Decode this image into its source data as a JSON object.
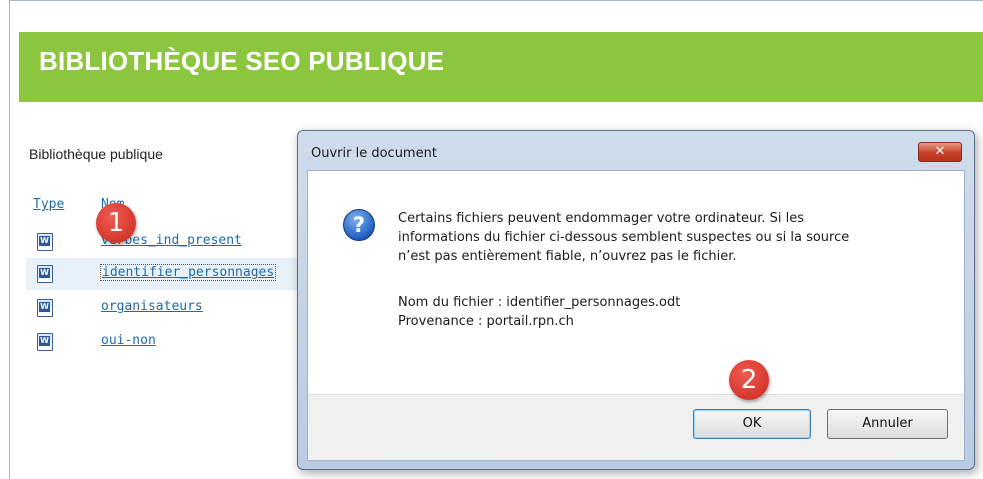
{
  "banner": {
    "title": "BIBLIOTHÈQUE SEO PUBLIQUE",
    "color": "#8cc63f"
  },
  "library": {
    "section_title": "Bibliothèque publique",
    "columns": {
      "type": "Type",
      "name": "Nom"
    },
    "files": [
      {
        "name": "verbes_ind_present",
        "icon": "word-doc-icon",
        "selected": false
      },
      {
        "name": "identifier_personnages",
        "icon": "word-doc-icon",
        "selected": true
      },
      {
        "name": "organisateurs",
        "icon": "word-doc-icon",
        "selected": false
      },
      {
        "name": "oui-non",
        "icon": "word-doc-icon",
        "selected": false
      }
    ]
  },
  "badges": {
    "first": "1",
    "second": "2",
    "color": "#d9342b"
  },
  "dialog": {
    "title": "Ouvrir le document",
    "close_label": "✕",
    "icon": "question-icon",
    "message_lines": [
      "Certains fichiers peuvent endommager votre ordinateur. Si les",
      "informations du fichier ci-dessous semblent suspectes ou si la source",
      "n’est pas entièrement fiable, n’ouvrez pas le fichier."
    ],
    "filename_line": "Nom du fichier : identifier_personnages.odt",
    "source_line": "Provenance : portail.rpn.ch",
    "ok_label": "OK",
    "cancel_label": "Annuler"
  }
}
